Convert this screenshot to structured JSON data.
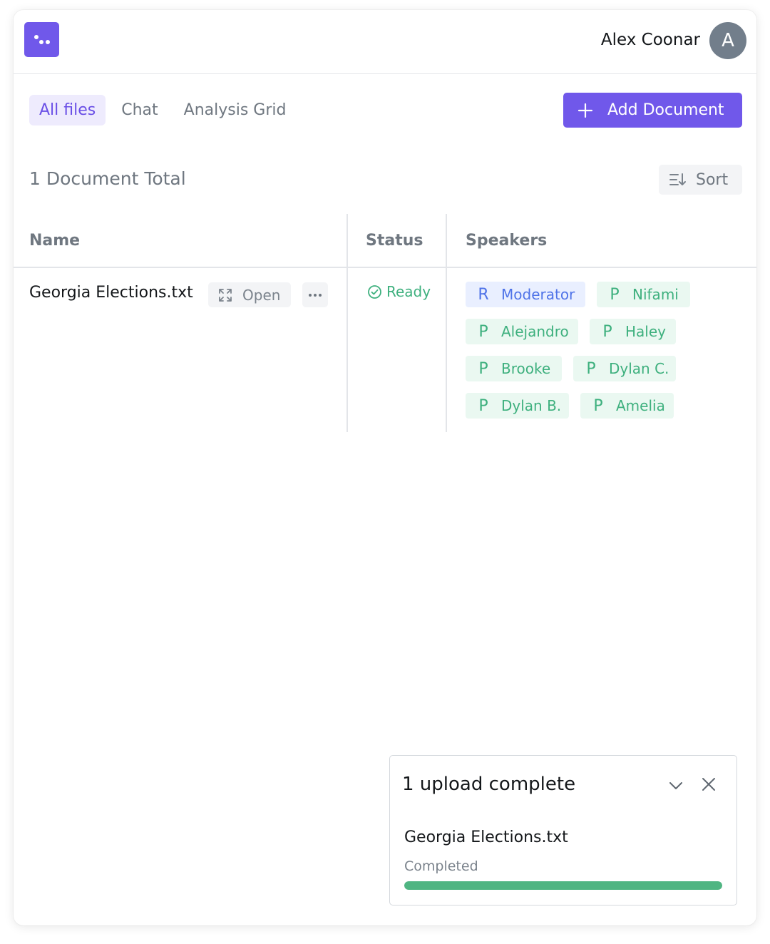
{
  "header": {
    "user_name": "Alex Coonar",
    "avatar_initial": "A"
  },
  "tabs": [
    {
      "label": "All files",
      "active": true
    },
    {
      "label": "Chat",
      "active": false
    },
    {
      "label": "Analysis Grid",
      "active": false
    }
  ],
  "toolbar": {
    "add_document_label": "Add Document",
    "doc_total": "1 Document Total",
    "sort_label": "Sort"
  },
  "table": {
    "columns": [
      "Name",
      "Status",
      "Speakers"
    ],
    "rows": [
      {
        "name": "Georgia Elections.txt",
        "open_label": "Open",
        "status": "Ready",
        "speakers": [
          {
            "tag": "R",
            "name": "Moderator"
          },
          {
            "tag": "P",
            "name": "Nifami"
          },
          {
            "tag": "P",
            "name": "Alejandro"
          },
          {
            "tag": "P",
            "name": "Haley"
          },
          {
            "tag": "P",
            "name": "Brooke"
          },
          {
            "tag": "P",
            "name": "Dylan C."
          },
          {
            "tag": "P",
            "name": "Dylan B."
          },
          {
            "tag": "P",
            "name": "Amelia"
          }
        ]
      }
    ]
  },
  "upload_toast": {
    "title": "1 upload complete",
    "file_name": "Georgia Elections.txt",
    "status": "Completed",
    "progress_percent": 100
  },
  "colors": {
    "accent": "#7058ea",
    "success": "#3eb07e",
    "progress": "#4fb582",
    "moderator_chip": "#e9efff",
    "participant_chip": "#eaf8f1"
  },
  "icons": [
    "logo-icon",
    "plus-icon",
    "sort-icon",
    "expand-icon",
    "more-icon",
    "check-circle-icon",
    "chevron-down-icon",
    "close-icon"
  ]
}
